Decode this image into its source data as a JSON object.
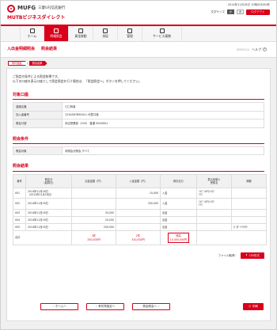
{
  "brand": {
    "logo": "MUFG",
    "bank": "三菱UFJ信託銀行",
    "service": "MUTBビジネスダイレクト"
  },
  "header": {
    "last_login": "2014年11月18日 10時00分00秒",
    "font_size_label": "文字サイズ",
    "font_small": "小",
    "font_large": "大",
    "logout": "ログアウト"
  },
  "nav": [
    {
      "label": "ホーム",
      "icon": "home-icon"
    },
    {
      "label": "明細照会",
      "icon": "document-icon"
    },
    {
      "label": "資金移動",
      "icon": "transfer-icon"
    },
    {
      "label": "承認",
      "icon": "approve-icon"
    },
    {
      "label": "管理",
      "icon": "settings-icon"
    },
    {
      "label": "サービス連携",
      "icon": "link-icon"
    }
  ],
  "title": {
    "page": "入出金明細照会",
    "sub": "照会結果",
    "screen_id": "BRP0020",
    "help": "ヘルプ"
  },
  "steps": [
    "条件指定",
    "照会結果"
  ],
  "intro": [
    "ご指定の条件による照会結果です。",
    "以下の口座を表示口座として照会照会を行う場合は、「照会照会へ」ボタンを押してください。"
  ],
  "account_section": {
    "title": "対象口座",
    "rows": [
      {
        "k": "連絡名義",
        "v": "〇〇商事"
      },
      {
        "k": "加入者番号",
        "v": "1234567890011 代表口座"
      },
      {
        "k": "照会口座",
        "v": "本店営業部（100） 普通 5000001"
      }
    ]
  },
  "condition_section": {
    "title": "照会条件",
    "rows": [
      {
        "k": "照会対象",
        "v": "未照会分照会 すべて"
      }
    ]
  },
  "result_section": {
    "title": "照会結果",
    "headers": [
      "番号",
      "照会日\n（起算日）",
      "出金金額（円）",
      "入金金額（円）",
      "取引区分",
      "振込依頼人\n受取名",
      "摘要"
    ],
    "rows": [
      {
        "no": "001",
        "date": "2014年11月18日\n（2014年11月18日）",
        "out": "",
        "in": "10,000",
        "type": "入金",
        "name": "ﾐﾂﾋﾞｼUFJｼﾝﾀｸ\nｱﾘﾏ",
        "memo": ""
      },
      {
        "no": "002",
        "date": "2014年11月18日",
        "out": "",
        "in": "200,000",
        "type": "入金",
        "name": "ﾐﾂﾋﾞｼUFJｼﾝﾀｸ\nｱﾘﾏ",
        "memo": ""
      },
      {
        "no": "003",
        "date": "2014年11月18日",
        "out": "30,000",
        "in": "",
        "type": "出金",
        "name": "",
        "memo": ""
      },
      {
        "no": "004",
        "date": "2014年11月18日",
        "out": "20,000",
        "in": "",
        "type": "出金",
        "name": "",
        "memo": ""
      },
      {
        "no": "005",
        "date": "2014年11月18日",
        "out": "200,000",
        "in": "",
        "type": "出金",
        "name": "",
        "memo": "ｶﾞｽﾀﾞｲﾄｳｷﾖｳ"
      }
    ],
    "total": {
      "label": "合計",
      "out_count": "3件",
      "out_amount": "250,000円",
      "in_count": "2件",
      "in_amount": "310,000円",
      "balance_label": "残高",
      "balance": "10,000,000円"
    }
  },
  "file": {
    "label": "ファイル取得：",
    "csv": "CSV形式"
  },
  "buttons": {
    "home": "ホームへ",
    "condition": "条件再指定へ",
    "inquiry": "照会照会へ",
    "print": "印刷"
  }
}
